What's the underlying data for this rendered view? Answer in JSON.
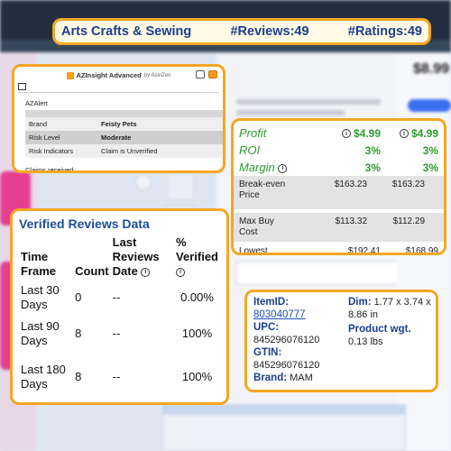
{
  "header": {
    "category": "Arts Crafts & Sewing",
    "reviews": "#Reviews:49",
    "ratings": "#Ratings:49"
  },
  "azinsight": {
    "title": "AZInsight Advanced",
    "by": "by AsinZen",
    "alert_label": "AZAlert",
    "rows": [
      {
        "label": "Brand",
        "value": "Feisty Pets"
      },
      {
        "label": "Risk Level",
        "value": "Moderate"
      },
      {
        "label": "Risk Indicators",
        "value": "Claim is Unverified"
      }
    ],
    "claims": "Claims received"
  },
  "profit": {
    "green_rows": [
      {
        "label": "Profit",
        "v1": "$4.99",
        "v2": "$4.99",
        "info_on_values": true
      },
      {
        "label": "ROI",
        "v1": "3%",
        "v2": "3%",
        "info_on_values": false
      },
      {
        "label": "Margin",
        "v1": "3%",
        "v2": "3%",
        "info_on_label": true
      }
    ],
    "detail_rows": [
      {
        "label": "Break-even Price",
        "v1": "$163.23",
        "v2": "$163.23"
      },
      {
        "label": "Max Buy Cost",
        "v1": "$113.32",
        "v2": "$112.29"
      },
      {
        "label": "Lowest",
        "v1": "$192.41",
        "v2": "$168.99"
      }
    ]
  },
  "reviews": {
    "title": "Verified Reviews Data",
    "columns": [
      "Time Frame",
      "Count",
      "Last Reviews Date",
      "% Verified"
    ],
    "rows": [
      {
        "frame": "Last 30 Days",
        "count": "0",
        "date": "--",
        "pct": "0.00%"
      },
      {
        "frame": "Last 90 Days",
        "count": "8",
        "date": "--",
        "pct": "100%"
      },
      {
        "frame": "Last 180 Days",
        "count": "8",
        "date": "--",
        "pct": "100%"
      }
    ]
  },
  "product": {
    "item_id_label": "ItemID:",
    "item_id": "803040777",
    "upc_label": "UPC:",
    "upc": "845296076120",
    "gtin_label": "GTIN:",
    "gtin": "845296076120",
    "brand_label": "Brand:",
    "brand": "MAM",
    "dim_label": "Dim:",
    "dim": "1.77 x 3.74 x 8.86 in",
    "weight_label": "Product wgt.",
    "weight": "0.13 lbs"
  },
  "background": {
    "price": "$8.99"
  }
}
